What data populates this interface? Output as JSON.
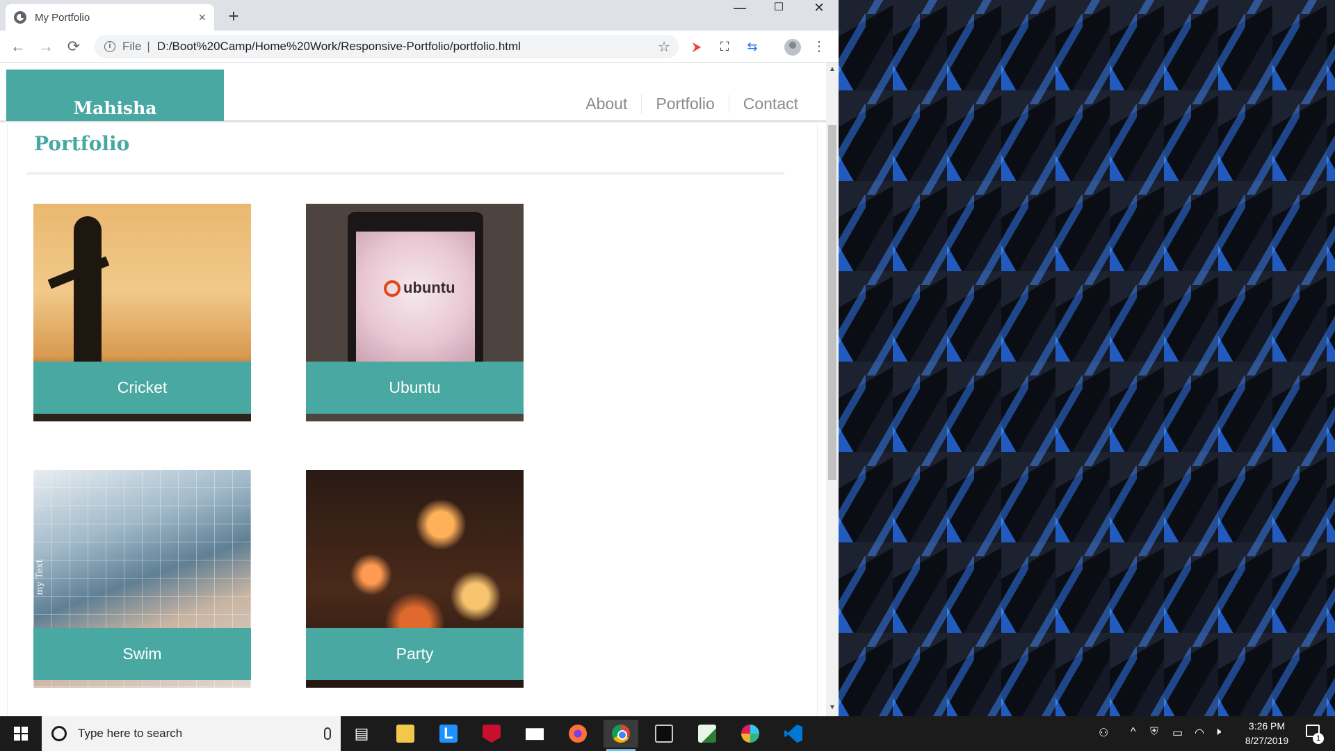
{
  "browser": {
    "tab_title": "My Portfolio",
    "tab_close": "×",
    "new_tab": "+",
    "window_controls": {
      "minimize": "—",
      "maximize": "☐",
      "close": "✕"
    },
    "nav": {
      "back": "←",
      "forward": "→",
      "reload": "⟳"
    },
    "omnibox": {
      "info_icon": "i",
      "scheme": "File",
      "separator": "|",
      "url": "D:/Boot%20Camp/Home%20Work/Responsive-Portfolio/portfolio.html",
      "star": "☆"
    },
    "extensions": [
      "⮞",
      "⛶",
      "⇆"
    ],
    "menu": "⋮"
  },
  "site": {
    "brand": "Mahisha",
    "nav": [
      "About",
      "Portfolio",
      "Contact"
    ],
    "page_title": "Portfolio",
    "accent_color": "#4aa8a2",
    "cards": [
      {
        "caption": "Cricket",
        "image": "cricket-photo"
      },
      {
        "caption": "Ubuntu",
        "image": "ubuntu-laptop-photo",
        "screen_text": "ubuntu"
      },
      {
        "caption": "Swim",
        "image": "swimmer-photo",
        "overlay_text": "my Text"
      },
      {
        "caption": "Party",
        "image": "party-lamps-photo"
      }
    ]
  },
  "scrollbar": {
    "up": "▲",
    "down": "▼"
  },
  "taskbar": {
    "search_placeholder": "Type here to search",
    "apps": [
      "task-view",
      "file-explorer",
      "l-app",
      "mcafee",
      "mail",
      "firefox",
      "chrome",
      "terminal",
      "notepad",
      "slack",
      "vscode"
    ],
    "active_app": "chrome",
    "tray": {
      "people": "⚇",
      "chevron": "^",
      "mcafee": "⛨",
      "battery": "▭",
      "wifi": "◠",
      "sound": "🕨"
    },
    "clock_time": "3:26 PM",
    "clock_date": "8/27/2019",
    "notification_count": "1"
  }
}
